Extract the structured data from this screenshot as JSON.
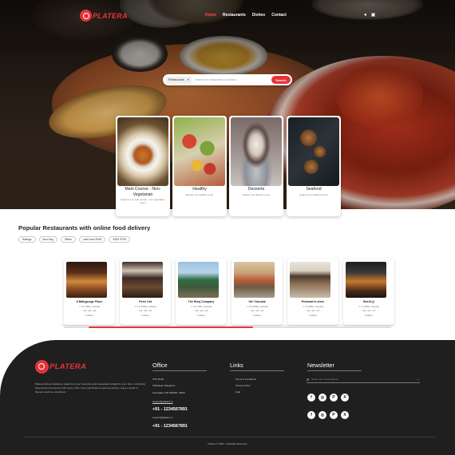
{
  "brand": {
    "name": "PLATERA",
    "accent": "#e8323b"
  },
  "nav": {
    "links": [
      {
        "label": "Home",
        "active": true
      },
      {
        "label": "Restaurants",
        "active": false
      },
      {
        "label": "Dishes",
        "active": false
      },
      {
        "label": "Contact",
        "active": false
      }
    ],
    "icons": [
      "user-icon",
      "cart-icon"
    ]
  },
  "search": {
    "select_value": "Restaurants",
    "placeholder": "Search for restaurants or dishes...",
    "button_label": "Search"
  },
  "categories": [
    {
      "title": "Main Course - Non-Vegetarian",
      "desc": "Explore our main course - non vegetarian menu"
    },
    {
      "title": "Healthy",
      "desc": "Explore our healthy menu"
    },
    {
      "title": "Desserts",
      "desc": "Explore our dessert menu"
    },
    {
      "title": "Seafood",
      "desc": "Explore our seafood menu"
    }
  ],
  "popular": {
    "title": "Popular Restaurants with online food delivery",
    "filters": [
      "Ratings",
      "Non-Veg",
      "Offers",
      "Less than ₹300",
      "₹300-₹700"
    ]
  },
  "restaurants": [
    {
      "name": "8 Ballygunge Place",
      "rating": "4.2 (500+ reviews)",
      "null_text": "null, null, null",
      "city": "Kolkata"
    },
    {
      "name": "Peter Cat",
      "rating": "4.4 (1000+ reviews)",
      "null_text": "null, null, null",
      "city": "Kolkata"
    },
    {
      "name": "The Bhoj Company",
      "rating": "4.0 (700+ reviews)",
      "null_text": "null, null, null",
      "city": "Kolkata"
    },
    {
      "name": "Oh! Calcutta",
      "rating": "4.5 (1200+ reviews)",
      "null_text": "null, null, null",
      "city": "Kolkata"
    },
    {
      "name": "Peshawri's store",
      "rating": "4.3 (800+ reviews)",
      "null_text": "null, null, null",
      "city": "Kolkata"
    },
    {
      "name": "Bar-B-Q",
      "rating": "4.1 (650+ reviews)",
      "null_text": "null, null, null",
      "city": "Kolkata"
    }
  ],
  "footer": {
    "about": "Platera delivers delicious meals from your favourite local restaurants straight to your door, combining speed and convenience with every order. From quick bites to gourmet dishes, enjoy a world of flavours anytime, anywhere!",
    "office": {
      "title": "Office",
      "lines": [
        "ITPL Road",
        "Whitefield, Bangalore",
        "Karnataka, PIN 560066, INDIA"
      ],
      "email": "support@platera.in",
      "phone1": "+91 - 1234567891",
      "email2": "support@platera.in",
      "phone2": "+91 - 1234567891"
    },
    "links": {
      "title": "Links",
      "items": [
        "Terms & Conditions",
        "Privacy Policy",
        "Help"
      ]
    },
    "newsletter": {
      "title": "Newsletter",
      "placeholder": "Enter your email address"
    },
    "socials": [
      "facebook-icon",
      "instagram-icon",
      "pinterest-icon",
      "x-icon"
    ],
    "copyright": "Platera © 2024 - All Rights Reserved"
  }
}
